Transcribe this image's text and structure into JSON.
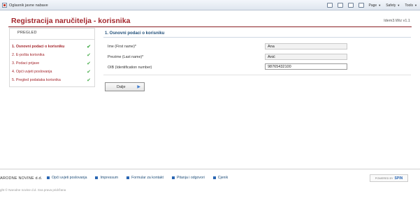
{
  "browser": {
    "tab_title": "Oglasnik javne nabave",
    "menu": {
      "page": "Page",
      "safety": "Safety",
      "tools": "Tools"
    }
  },
  "header": {
    "title": "Registracija naručitelja - korisnika",
    "version": "Idem3.Wiz v1.1"
  },
  "sidebar": {
    "heading": "PREGLED",
    "items": [
      {
        "label": "1. Osnovni podaci o korisniku",
        "check": "✔"
      },
      {
        "label": "2. E-pošta korisnika",
        "check": "✔"
      },
      {
        "label": "3. Podaci prijave",
        "check": "✔"
      },
      {
        "label": "4. Opći uvjeti poslovanja",
        "check": "✔"
      },
      {
        "label": "5. Pregled podataka korisnika",
        "check": "✔"
      }
    ]
  },
  "form": {
    "section_title": "1. Osnovni podaci o korisniku",
    "fields": [
      {
        "label": "Ime (First name)*",
        "value": "Ana"
      },
      {
        "label": "Prezime (Last name)*",
        "value": "Anić"
      },
      {
        "label": "OIB (Identification number)",
        "value": "98765432100"
      }
    ],
    "next_label": "Dalje",
    "next_icon": "▶"
  },
  "footer": {
    "brand": "ARODNE NOVINE d.d.",
    "links": [
      "Opći uvjeti poslovanja",
      "Impressum",
      "Formular za kontakt",
      "Pitanja i odgovori",
      "Cjenik"
    ],
    "powered_prefix": "POWERED BY",
    "powered_brand": "SPIN",
    "copyright": "ght © Narodne novine d.d. Sva prava pridržana"
  },
  "colors": {
    "brand_red": "#a4262c",
    "link_blue": "#1f4e79",
    "check_green": "#4caf50"
  }
}
